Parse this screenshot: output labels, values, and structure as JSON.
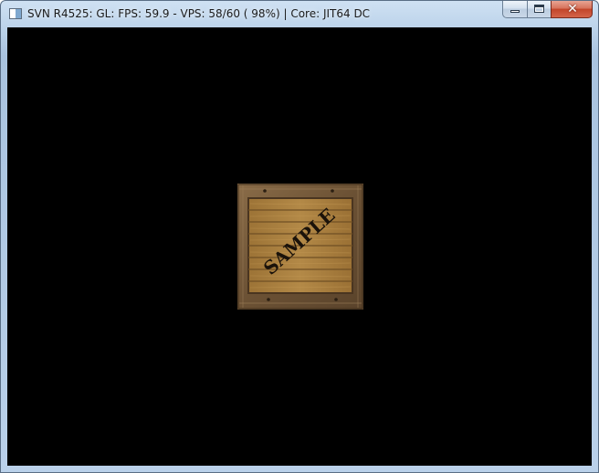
{
  "window": {
    "title": "SVN R4525: GL: FPS: 59.9 - VPS: 58/60 ( 98%) | Core: JIT64 DC",
    "buttons": {
      "minimize_glyph": "",
      "maximize_glyph": "",
      "close_glyph": "✕"
    }
  },
  "viewport": {
    "background": "#000000",
    "crate": {
      "stencil_text": "SAMPLE",
      "wood_color": "#a2793d",
      "frame_color": "#6e5537"
    }
  },
  "icons": [
    "app-icon",
    "minimize-icon",
    "maximize-icon",
    "close-icon"
  ]
}
